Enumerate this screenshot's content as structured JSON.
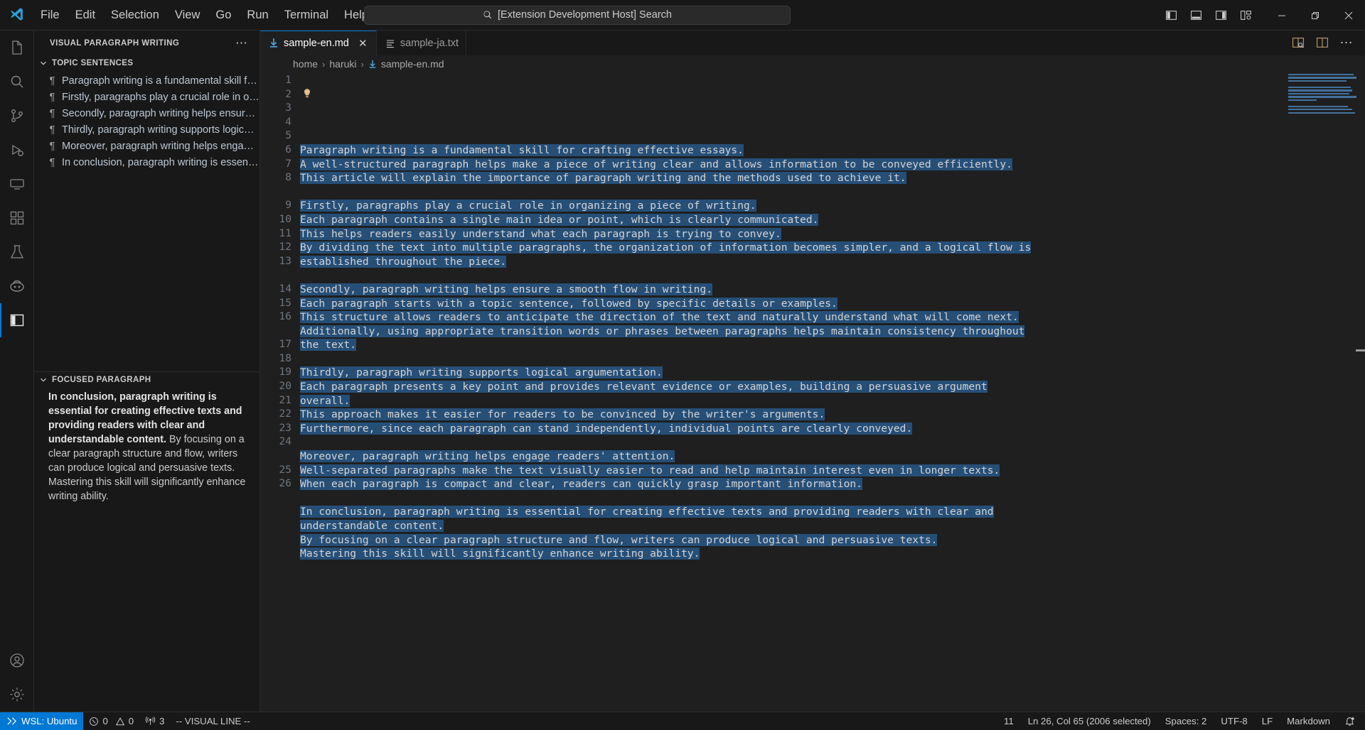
{
  "titlebar": {
    "logo_icon": "vscode-logo-icon",
    "menus": [
      "File",
      "Edit",
      "Selection",
      "View",
      "Go",
      "Run",
      "Terminal",
      "Help"
    ],
    "nav_back_icon": "arrow-left-icon",
    "nav_forward_icon": "arrow-right-icon",
    "command_center": {
      "search_icon": "search-icon",
      "text": "[Extension Development Host] Search"
    },
    "layout_icons": [
      "toggle-primary-sidebar-icon",
      "toggle-panel-icon",
      "toggle-secondary-sidebar-icon",
      "customize-layout-icon"
    ],
    "window_controls": {
      "minimize": "minimize-icon",
      "restore": "restore-icon",
      "close": "close-icon"
    }
  },
  "activitybar": {
    "items": [
      {
        "name": "explorer",
        "icon": "files-icon",
        "active": false
      },
      {
        "name": "search",
        "icon": "search-icon",
        "active": false
      },
      {
        "name": "source-control",
        "icon": "source-control-icon",
        "active": false
      },
      {
        "name": "run-and-debug",
        "icon": "debug-icon",
        "active": false
      },
      {
        "name": "remote-explorer",
        "icon": "remote-explorer-icon",
        "active": false
      },
      {
        "name": "extensions",
        "icon": "extensions-icon",
        "active": false
      },
      {
        "name": "testing",
        "icon": "beaker-icon",
        "active": false
      },
      {
        "name": "copilot",
        "icon": "copilot-icon",
        "active": false
      },
      {
        "name": "visual-paragraph-writing",
        "icon": "panel-layout-icon",
        "active": true
      }
    ],
    "bottom_items": [
      {
        "name": "accounts",
        "icon": "account-icon"
      },
      {
        "name": "manage-settings",
        "icon": "gear-icon"
      }
    ]
  },
  "sidebar": {
    "title": "VISUAL PARAGRAPH WRITING",
    "more_actions_icon": "ellipsis-icon",
    "sections": [
      {
        "name": "topic-sentences",
        "header": "TOPIC SENTENCES",
        "chevron_icon": "chevron-down-icon",
        "items": [
          {
            "icon": "pilcrow-icon",
            "label": "Paragraph writing is a fundamental skill for crafting effective essays."
          },
          {
            "icon": "pilcrow-icon",
            "label": "Firstly, paragraphs play a crucial role in organizing a piece of writing."
          },
          {
            "icon": "pilcrow-icon",
            "label": "Secondly, paragraph writing helps ensure a smooth flow in writing."
          },
          {
            "icon": "pilcrow-icon",
            "label": "Thirdly, paragraph writing supports logical argumentation."
          },
          {
            "icon": "pilcrow-icon",
            "label": "Moreover, paragraph writing helps engage readers' attention."
          },
          {
            "icon": "pilcrow-icon",
            "label": "In conclusion, paragraph writing is essential for creating effective texts."
          }
        ]
      },
      {
        "name": "focused-paragraph",
        "header": "FOCUSED PARAGRAPH",
        "chevron_icon": "chevron-down-icon",
        "bold_text": "In conclusion, paragraph writing is essential for creating effective texts and providing readers with clear and understandable content.",
        "rest_text": " By focusing on a clear paragraph structure and flow, writers can produce logical and persuasive texts. Mastering this skill will significantly enhance writing ability."
      }
    ]
  },
  "editor": {
    "tabs": [
      {
        "label": "sample-en.md",
        "icon": "markdown-file-icon",
        "active": true,
        "close_icon": "close-icon"
      },
      {
        "label": "sample-ja.txt",
        "icon": "text-file-icon",
        "active": false,
        "close_icon": ""
      }
    ],
    "actions": [
      "split-editor-right-icon",
      "open-changes-icon",
      "more-actions-icon"
    ],
    "breadcrumbs": [
      {
        "label": "home",
        "icon": ""
      },
      {
        "label": "haruki",
        "icon": ""
      },
      {
        "label": "sample-en.md",
        "icon": "markdown-file-icon"
      }
    ],
    "separator": "›",
    "lightbulb_icon": "lightbulb-icon",
    "lines": [
      {
        "num": "1",
        "text": "Paragraph writing is a fundamental skill for crafting effective essays.",
        "selected": true
      },
      {
        "num": "2",
        "text": "A well-structured paragraph helps make a piece of writing clear and allows information to be conveyed efficiently.",
        "selected": true
      },
      {
        "num": "3",
        "text": "This article will explain the importance of paragraph writing and the methods used to achieve it.",
        "selected": true
      },
      {
        "num": "4",
        "text": "",
        "selected": false
      },
      {
        "num": "5",
        "text": "Firstly, paragraphs play a crucial role in organizing a piece of writing.",
        "selected": true
      },
      {
        "num": "6",
        "text": "Each paragraph contains a single main idea or point, which is clearly communicated.",
        "selected": true
      },
      {
        "num": "7",
        "text": "This helps readers easily understand what each paragraph is trying to convey.",
        "selected": true
      },
      {
        "num": "8",
        "text": "By dividing the text into multiple paragraphs, the organization of information becomes simpler, and a logical flow is established throughout the piece.",
        "selected": true
      },
      {
        "num": "9",
        "text": "",
        "selected": false
      },
      {
        "num": "10",
        "text": "Secondly, paragraph writing helps ensure a smooth flow in writing.",
        "selected": true
      },
      {
        "num": "11",
        "text": "Each paragraph starts with a topic sentence, followed by specific details or examples.",
        "selected": true
      },
      {
        "num": "12",
        "text": "This structure allows readers to anticipate the direction of the text and naturally understand what will come next.",
        "selected": true
      },
      {
        "num": "13",
        "text": "Additionally, using appropriate transition words or phrases between paragraphs helps maintain consistency throughout the text.",
        "selected": true
      },
      {
        "num": "14",
        "text": "",
        "selected": false
      },
      {
        "num": "15",
        "text": "Thirdly, paragraph writing supports logical argumentation.",
        "selected": true
      },
      {
        "num": "16",
        "text": "Each paragraph presents a key point and provides relevant evidence or examples, building a persuasive argument overall.",
        "selected": true
      },
      {
        "num": "17",
        "text": "This approach makes it easier for readers to be convinced by the writer's arguments.",
        "selected": true
      },
      {
        "num": "18",
        "text": "Furthermore, since each paragraph can stand independently, individual points are clearly conveyed.",
        "selected": true
      },
      {
        "num": "19",
        "text": "",
        "selected": false
      },
      {
        "num": "20",
        "text": "Moreover, paragraph writing helps engage readers' attention.",
        "selected": true
      },
      {
        "num": "21",
        "text": "Well-separated paragraphs make the text visually easier to read and help maintain interest even in longer texts.",
        "selected": true
      },
      {
        "num": "22",
        "text": "When each paragraph is compact and clear, readers can quickly grasp important information.",
        "selected": true
      },
      {
        "num": "23",
        "text": "",
        "selected": false
      },
      {
        "num": "24",
        "text": "In conclusion, paragraph writing is essential for creating effective texts and providing readers with clear and understandable content.",
        "selected": true
      },
      {
        "num": "25",
        "text": "By focusing on a clear paragraph structure and flow, writers can produce logical and persuasive texts.",
        "selected": true
      },
      {
        "num": "26",
        "text": "Mastering this skill will significantly enhance writing ability.",
        "selected": true
      }
    ],
    "wrap_width_chars": 117,
    "selection_color": "#264f78",
    "minimap_color": "#44719e"
  },
  "statusbar": {
    "remote": {
      "icon": "remote-icon",
      "label": "WSL: Ubuntu",
      "color": "#0078d4"
    },
    "problems": {
      "error_icon": "error-circle-icon",
      "errors": "0",
      "warning_icon": "warning-triangle-icon",
      "warnings": "0"
    },
    "ports": {
      "icon": "radio-tower-icon",
      "count": "3"
    },
    "mode": "-- VISUAL LINE --",
    "right_items": [
      {
        "name": "word-count",
        "label": "11"
      },
      {
        "name": "cursor-position",
        "label": "Ln 26, Col 65 (2006 selected)"
      },
      {
        "name": "indentation",
        "label": "Spaces: 2"
      },
      {
        "name": "encoding",
        "label": "UTF-8"
      },
      {
        "name": "eol",
        "label": "LF"
      },
      {
        "name": "language-mode",
        "label": "Markdown"
      },
      {
        "name": "notifications",
        "label": "",
        "icon": "bell-dot-icon"
      }
    ]
  }
}
